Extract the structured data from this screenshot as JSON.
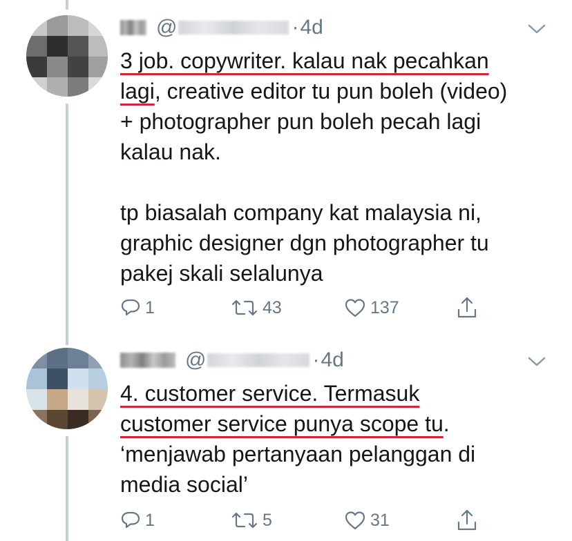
{
  "tweets": [
    {
      "time": "4d",
      "at": "@",
      "dot": "·",
      "text": {
        "u1": "3 job. copywriter. kalau nak pecahkan",
        "u2": "lagi",
        "rest1": ", creative editor tu pun boleh (video)",
        "line3": "+ photographer pun boleh pecah lagi",
        "line4": "kalau nak.",
        "line5": "tp biasalah company kat malaysia ni,",
        "line6": "graphic designer dgn photographer tu",
        "line7": "pakej skali selalunya"
      },
      "replies": "1",
      "retweets": "43",
      "likes": "137"
    },
    {
      "time": "4d",
      "at": "@",
      "dot": "·",
      "text": {
        "u1": "4. customer service. Termasuk",
        "u2": "customer service punya scope tu",
        "rest2": ".",
        "line3": "‘menjawab pertanyaan pelanggan di",
        "line4": "media social’"
      },
      "replies": "1",
      "retweets": "5",
      "likes": "31"
    }
  ],
  "colors": {
    "text": "#14171a",
    "meta": "#657786",
    "underline": "#d0253a",
    "thread_line": "#c4cfd6"
  },
  "icons": [
    "reply-icon",
    "retweet-icon",
    "like-icon",
    "share-icon",
    "chevron-down-icon"
  ]
}
